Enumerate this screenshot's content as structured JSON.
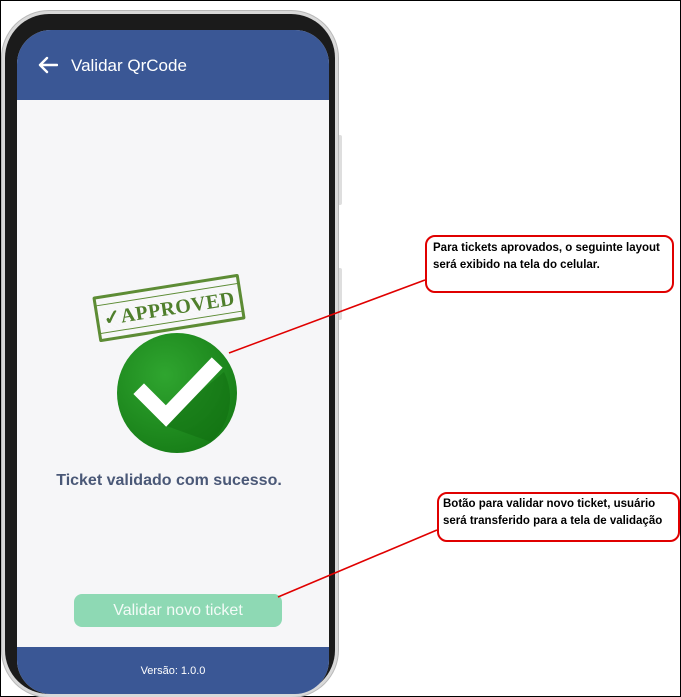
{
  "app": {
    "title": "Validar QrCode",
    "back_icon": "arrow-left-icon",
    "stamp_text": "✓APPROVED",
    "status_icon": "check-circle-icon",
    "message": "Ticket validado com sucesso.",
    "button_label": "Validar novo ticket",
    "footer": "Versão: 1.0.0"
  },
  "annotations": [
    {
      "text": "Para tickets aprovados, o seguinte layout será exibido na tela do celular."
    },
    {
      "text": "Botão para validar novo ticket, usuário será transferido para a tela de validação"
    }
  ],
  "colors": {
    "header": "#3a5795",
    "button": "#8ed9b4",
    "check_green": "#1f8f1f",
    "callout_border": "#e00000"
  }
}
